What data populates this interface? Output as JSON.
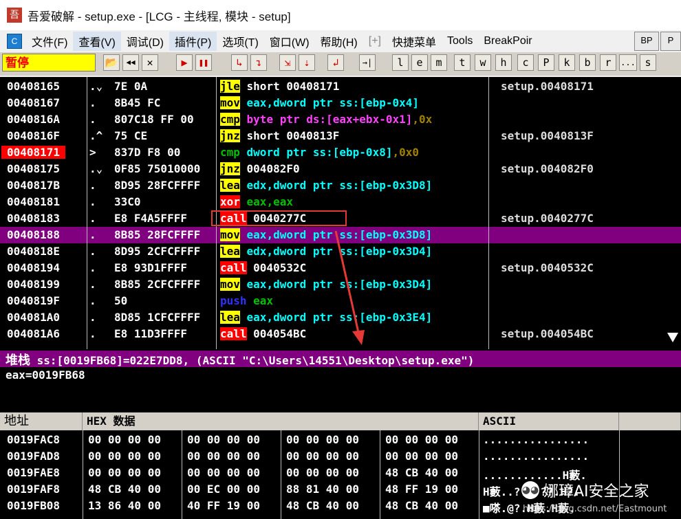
{
  "window": {
    "title": "吾爱破解 - setup.exe - [LCG - 主线程, 模块 - setup]",
    "icon": "吾"
  },
  "menu": {
    "logo": "C",
    "items": [
      "文件(F)",
      "查看(V)",
      "调试(D)",
      "插件(P)",
      "选项(T)",
      "窗口(W)",
      "帮助(H)",
      "[+]",
      "快捷菜单",
      "Tools",
      "BreakPoir"
    ],
    "right_buttons": [
      "BP",
      "P"
    ]
  },
  "toolbar": {
    "status": "暂停",
    "play_buttons": [
      "📂",
      "◀◀",
      "✕",
      "▶",
      "❚❚",
      "↳",
      "↴",
      "⇲",
      "⇣",
      "↲",
      "→|"
    ],
    "letter_buttons": [
      "l",
      "e",
      "m",
      "t",
      "w",
      "h",
      "c",
      "P",
      "k",
      "b",
      "r",
      "...",
      "s"
    ]
  },
  "disasm": [
    {
      "addr": "00408165",
      "mark": ".⌄",
      "hex": "7E 0A",
      "mn": [
        [
          "jle",
          "y"
        ],
        [
          " short 00408171",
          "w"
        ]
      ],
      "cmt": "setup.00408171"
    },
    {
      "addr": "00408167",
      "mark": ".",
      "hex": "8B45 FC",
      "mn": [
        [
          "mov",
          "y0"
        ],
        [
          " eax,dword ptr ss:[ebp-0x4]",
          "cy"
        ]
      ],
      "cmt": ""
    },
    {
      "addr": "0040816A",
      "mark": ".",
      "hex": "807C18 FF 00",
      "mn": [
        [
          "cmp",
          "y0"
        ],
        [
          " byte ptr ds:[eax+ebx-0x1]",
          "pk"
        ],
        [
          ",0x",
          "ol"
        ]
      ],
      "cmt": ""
    },
    {
      "addr": "0040816F",
      "mark": ".^",
      "hex": "75 CE",
      "mn": [
        [
          "jnz",
          "y"
        ],
        [
          " short 0040813F",
          "w"
        ]
      ],
      "cmt": "setup.0040813F"
    },
    {
      "addr": "00408171",
      "mark": ">",
      "hex": "837D F8 00",
      "mn": [
        [
          "cmp",
          "g"
        ],
        [
          " dword ptr ss:[ebp-0x8]",
          "cy"
        ],
        [
          ",0x0",
          "ol"
        ]
      ],
      "cmt": "",
      "cur": true
    },
    {
      "addr": "00408175",
      "mark": ".⌄",
      "hex": "0F85 75010000",
      "mn": [
        [
          "jnz",
          "y"
        ],
        [
          " 004082F0",
          "w"
        ]
      ],
      "cmt": "setup.004082F0"
    },
    {
      "addr": "0040817B",
      "mark": ".",
      "hex": "8D95 28FCFFFF",
      "mn": [
        [
          "lea",
          "y0"
        ],
        [
          " edx,dword ptr ss:[ebp-0x3D8]",
          "cy"
        ]
      ],
      "cmt": ""
    },
    {
      "addr": "00408181",
      "mark": ".",
      "hex": "33C0",
      "mn": [
        [
          "xor",
          "r0"
        ],
        [
          " eax,eax",
          "g"
        ]
      ],
      "cmt": ""
    },
    {
      "addr": "00408183",
      "mark": ".",
      "hex": "E8 F4A5FFFF",
      "mn": [
        [
          "call",
          "r"
        ],
        [
          " 0040277C",
          "w"
        ]
      ],
      "cmt": "setup.0040277C"
    },
    {
      "addr": "00408188",
      "mark": ".",
      "hex": "8B85 28FCFFFF",
      "mn": [
        [
          "mov",
          "y0"
        ],
        [
          " eax,dword ptr ss:[ebp-0x3D8]",
          "cy"
        ]
      ],
      "cmt": "",
      "sel": true
    },
    {
      "addr": "0040818E",
      "mark": ".",
      "hex": "8D95 2CFCFFFF",
      "mn": [
        [
          "lea",
          "y0"
        ],
        [
          " edx,dword ptr ss:[ebp-0x3D4]",
          "cy"
        ]
      ],
      "cmt": ""
    },
    {
      "addr": "00408194",
      "mark": ".",
      "hex": "E8 93D1FFFF",
      "mn": [
        [
          "call",
          "r"
        ],
        [
          " 0040532C",
          "w"
        ]
      ],
      "cmt": "setup.0040532C"
    },
    {
      "addr": "00408199",
      "mark": ".",
      "hex": "8B85 2CFCFFFF",
      "mn": [
        [
          "mov",
          "y0"
        ],
        [
          " eax,dword ptr ss:[ebp-0x3D4]",
          "cy"
        ]
      ],
      "cmt": ""
    },
    {
      "addr": "0040819F",
      "mark": ".",
      "hex": "50",
      "mn": [
        [
          "push",
          "bl"
        ],
        [
          " eax",
          "g"
        ]
      ],
      "cmt": ""
    },
    {
      "addr": "004081A0",
      "mark": ".",
      "hex": "8D85 1CFCFFFF",
      "mn": [
        [
          "lea",
          "y0"
        ],
        [
          " eax,dword ptr ss:[ebp-0x3E4]",
          "cy"
        ]
      ],
      "cmt": ""
    },
    {
      "addr": "004081A6",
      "mark": ".",
      "hex": "E8 11D3FFFF",
      "mn": [
        [
          "call",
          "r"
        ],
        [
          " 004054BC",
          "w"
        ]
      ],
      "cmt": "setup.004054BC"
    }
  ],
  "info": {
    "label": "堆栈",
    "line1": " ss:[0019FB68]=022E7DD8, (ASCII \"C:\\Users\\14551\\Desktop\\setup.exe\")",
    "line2": "eax=0019FB68"
  },
  "dump": {
    "headers": {
      "addr": "地址",
      "hex": "HEX 数据",
      "ascii": "ASCII"
    },
    "rows": [
      {
        "addr": "0019FAC8",
        "g": [
          "00 00 00 00",
          "00 00 00 00",
          "00 00 00 00",
          "00 00 00 00"
        ],
        "ascii": "................"
      },
      {
        "addr": "0019FAD8",
        "g": [
          "00 00 00 00",
          "00 00 00 00",
          "00 00 00 00",
          "00 00 00 00"
        ],
        "ascii": "................"
      },
      {
        "addr": "0019FAE8",
        "g": [
          "00 00 00 00",
          "00 00 00 00",
          "00 00 00 00",
          "48 CB 40 00"
        ],
        "ascii": "............H藪."
      },
      {
        "addr": "0019FAF8",
        "g": [
          "48 CB 40 00",
          "00 EC 00 00",
          "88 81 40 00",
          "48 FF 19 00"
        ],
        "ascii": "H藪..?..???.H?."
      },
      {
        "addr": "0019FB08",
        "g": [
          "13 86 40 00",
          "40 FF 19 00",
          "48 CB 40 00",
          "48 CB 40 00"
        ],
        "ascii": "■嗏.@?.H藪.H藪."
      }
    ]
  },
  "watermark": {
    "name": "娜璋AI安全之家",
    "url": "https://blog.csdn.net/Eastmount"
  }
}
